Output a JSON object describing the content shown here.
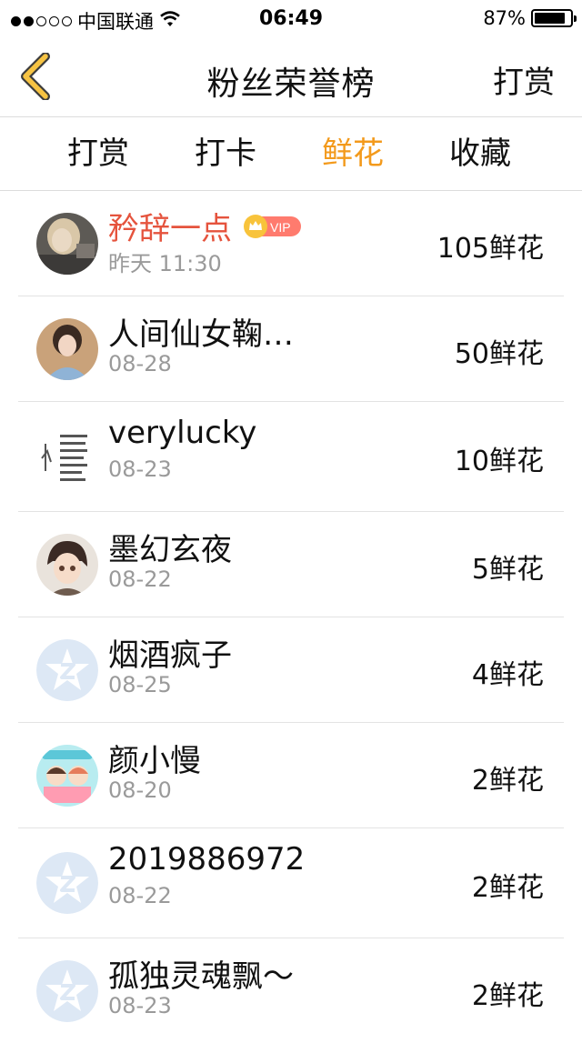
{
  "status_bar": {
    "carrier": "中国联通",
    "time": "06:49",
    "battery_text": "87%",
    "battery_level": 0.87,
    "signal_bars_filled": 2,
    "signal_bars_total": 5
  },
  "nav": {
    "title": "粉丝荣誉榜",
    "action_label": "打赏",
    "back_icon": "chevron-left-icon",
    "accent_color": "#f6c343"
  },
  "tabs": [
    {
      "label": "打赏",
      "active": false
    },
    {
      "label": "打卡",
      "active": false
    },
    {
      "label": "鲜花",
      "active": true
    },
    {
      "label": "收藏",
      "active": false
    }
  ],
  "vip_badge": {
    "text": "VIP",
    "icon": "crown-icon",
    "color": "#ff7b6e"
  },
  "fans": [
    {
      "name": "矜辞一点",
      "date": "昨天 11:30",
      "amount": "105鲜花",
      "vip": true,
      "avatar": "photo-avatar"
    },
    {
      "name": "人间仙女鞠…",
      "date": "08-28",
      "amount": "50鲜花",
      "vip": false,
      "avatar": "photo-avatar"
    },
    {
      "name": "verylucky",
      "date": "08-23",
      "amount": "10鲜花",
      "vip": false,
      "avatar": "text-image-avatar"
    },
    {
      "name": "墨幻玄夜",
      "date": "08-22",
      "amount": "5鲜花",
      "vip": false,
      "avatar": "anime-avatar"
    },
    {
      "name": "烟酒疯子",
      "date": "08-25",
      "amount": "4鲜花",
      "vip": false,
      "avatar": "default-qzone-avatar"
    },
    {
      "name": "颜小慢",
      "date": "08-20",
      "amount": "2鲜花",
      "vip": false,
      "avatar": "cartoon-avatar"
    },
    {
      "name": "2019886972",
      "date": "08-22",
      "amount": "2鲜花",
      "vip": false,
      "avatar": "default-qzone-avatar"
    },
    {
      "name": "孤独灵魂飘～",
      "date": "08-23",
      "amount": "2鲜花",
      "vip": false,
      "avatar": "default-qzone-avatar"
    }
  ]
}
